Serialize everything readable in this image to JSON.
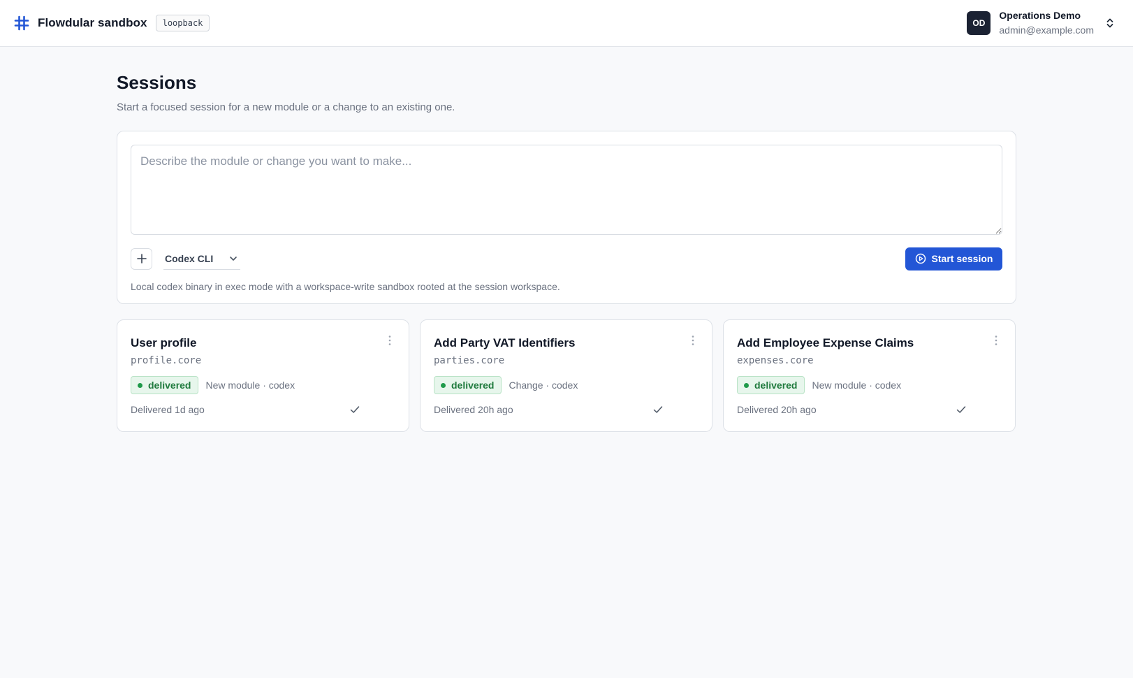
{
  "app": {
    "name": "Flowdular sandbox",
    "env_badge": "loopback"
  },
  "account": {
    "initials": "OD",
    "name": "Operations Demo",
    "email": "admin@example.com"
  },
  "page": {
    "title": "Sessions",
    "subtitle": "Start a focused session for a new module or a change to an existing one."
  },
  "composer": {
    "placeholder": "Describe the module or change you want to make...",
    "value": "",
    "agent_selected": "Codex CLI",
    "start_label": "Start session",
    "agent_description": "Local codex binary in exec mode with a workspace-write sandbox rooted at the session workspace."
  },
  "sessions": [
    {
      "title": "User profile",
      "module": "profile.core",
      "status": "delivered",
      "kind": "New module · codex",
      "time": "Delivered 1d ago"
    },
    {
      "title": "Add Party VAT Identifiers",
      "module": "parties.core",
      "status": "delivered",
      "kind": "Change · codex",
      "time": "Delivered 20h ago"
    },
    {
      "title": "Add Employee Expense Claims",
      "module": "expenses.core",
      "status": "delivered",
      "kind": "New module · codex",
      "time": "Delivered 20h ago"
    }
  ],
  "colors": {
    "accent": "#2356d6",
    "status_delivered": "#1f9a4a",
    "avatar_bg": "#1b2233"
  },
  "icons": {
    "logo": "hash-logo-icon",
    "account_switch": "chevron-up-down-icon",
    "add": "plus-icon",
    "agent_dropdown": "chevron-down-icon",
    "start": "play-circle-icon",
    "card_menu": "kebab-icon",
    "card_done": "check-icon"
  }
}
